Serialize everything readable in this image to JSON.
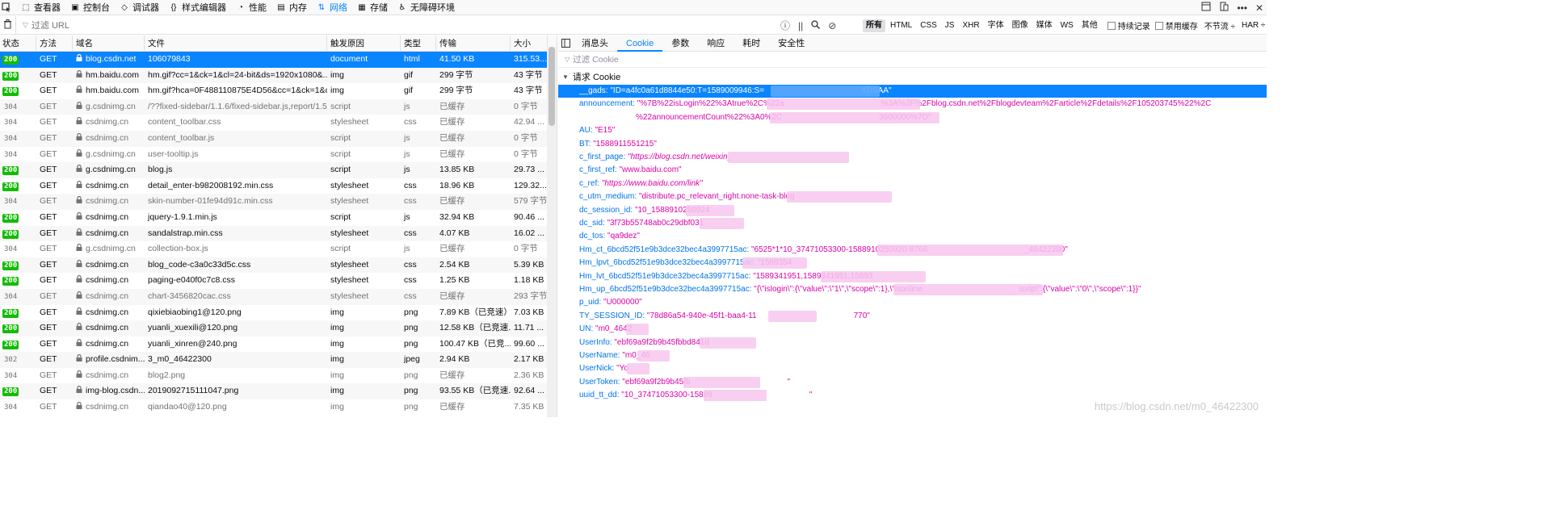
{
  "toolbar": {
    "tabs": [
      {
        "label": "查看器",
        "icon": "inspector-icon"
      },
      {
        "label": "控制台",
        "icon": "console-icon"
      },
      {
        "label": "调试器",
        "icon": "debugger-icon"
      },
      {
        "label": "样式编辑器",
        "icon": "style-editor-icon"
      },
      {
        "label": "性能",
        "icon": "performance-icon"
      },
      {
        "label": "内存",
        "icon": "memory-icon"
      },
      {
        "label": "网络",
        "icon": "network-icon"
      },
      {
        "label": "存储",
        "icon": "storage-icon"
      },
      {
        "label": "无障碍环境",
        "icon": "accessibility-icon"
      }
    ],
    "active_tab": "网络"
  },
  "filterbar": {
    "url_placeholder": "过滤 URL",
    "types": [
      "所有",
      "HTML",
      "CSS",
      "JS",
      "XHR",
      "字体",
      "图像",
      "媒体",
      "WS",
      "其他"
    ],
    "active_type": "所有",
    "persist_logs": "持续记录",
    "disable_cache": "禁用缓存",
    "throttle": "不节流 ÷",
    "har": "HAR ÷"
  },
  "table": {
    "columns": [
      "状态",
      "方法",
      "域名",
      "文件",
      "触发原因",
      "类型",
      "传输",
      "大小"
    ],
    "rows": [
      {
        "status": "200",
        "method": "GET",
        "domain": "blog.csdn.net",
        "file": "106079843",
        "cause": "document",
        "type": "html",
        "transfer": "41.50 KB",
        "size": "315.53...",
        "lock": true,
        "cached": false
      },
      {
        "status": "200",
        "method": "GET",
        "domain": "hm.baidu.com",
        "file": "hm.gif?cc=1&ck=1&cl=24-bit&ds=1920x1080&...",
        "cause": "img",
        "type": "gif",
        "transfer": "299 字节",
        "size": "43 字节",
        "lock": true,
        "cached": false
      },
      {
        "status": "200",
        "method": "GET",
        "domain": "hm.baidu.com",
        "file": "hm.gif?hca=0F488110875E4D56&cc=1&ck=1&c...",
        "cause": "img",
        "type": "gif",
        "transfer": "299 字节",
        "size": "43 字节",
        "lock": true,
        "cached": false
      },
      {
        "status": "304",
        "method": "GET",
        "domain": "g.csdnimg.cn",
        "file": "/??fixed-sidebar/1.1.6/fixed-sidebar.js,report/1.5...",
        "cause": "script",
        "type": "js",
        "transfer": "已缓存",
        "size": "0 字节",
        "lock": true,
        "cached": true
      },
      {
        "status": "304",
        "method": "GET",
        "domain": "csdnimg.cn",
        "file": "content_toolbar.css",
        "cause": "stylesheet",
        "type": "css",
        "transfer": "已缓存",
        "size": "42.94 ...",
        "lock": true,
        "cached": true
      },
      {
        "status": "304",
        "method": "GET",
        "domain": "csdnimg.cn",
        "file": "content_toolbar.js",
        "cause": "script",
        "type": "js",
        "transfer": "已缓存",
        "size": "0 字节",
        "lock": true,
        "cached": true
      },
      {
        "status": "304",
        "method": "GET",
        "domain": "g.csdnimg.cn",
        "file": "user-tooltip.js",
        "cause": "script",
        "type": "js",
        "transfer": "已缓存",
        "size": "0 字节",
        "lock": true,
        "cached": true
      },
      {
        "status": "200",
        "method": "GET",
        "domain": "g.csdnimg.cn",
        "file": "blog.js",
        "cause": "script",
        "type": "js",
        "transfer": "13.85 KB",
        "size": "29.73 ...",
        "lock": true,
        "cached": false
      },
      {
        "status": "200",
        "method": "GET",
        "domain": "csdnimg.cn",
        "file": "detail_enter-b982008192.min.css",
        "cause": "stylesheet",
        "type": "css",
        "transfer": "18.96 KB",
        "size": "129.32...",
        "lock": true,
        "cached": false
      },
      {
        "status": "304",
        "method": "GET",
        "domain": "csdnimg.cn",
        "file": "skin-number-01fe94d91c.min.css",
        "cause": "stylesheet",
        "type": "css",
        "transfer": "已缓存",
        "size": "579 字节",
        "lock": true,
        "cached": true
      },
      {
        "status": "200",
        "method": "GET",
        "domain": "csdnimg.cn",
        "file": "jquery-1.9.1.min.js",
        "cause": "script",
        "type": "js",
        "transfer": "32.94 KB",
        "size": "90.46 ...",
        "lock": true,
        "cached": false
      },
      {
        "status": "200",
        "method": "GET",
        "domain": "csdnimg.cn",
        "file": "sandalstrap.min.css",
        "cause": "stylesheet",
        "type": "css",
        "transfer": "4.07 KB",
        "size": "16.02 ...",
        "lock": true,
        "cached": false
      },
      {
        "status": "304",
        "method": "GET",
        "domain": "g.csdnimg.cn",
        "file": "collection-box.js",
        "cause": "script",
        "type": "js",
        "transfer": "已缓存",
        "size": "0 字节",
        "lock": true,
        "cached": true
      },
      {
        "status": "200",
        "method": "GET",
        "domain": "csdnimg.cn",
        "file": "blog_code-c3a0c33d5c.css",
        "cause": "stylesheet",
        "type": "css",
        "transfer": "2.54 KB",
        "size": "5.39 KB",
        "lock": true,
        "cached": false
      },
      {
        "status": "200",
        "method": "GET",
        "domain": "csdnimg.cn",
        "file": "paging-e040f0c7c8.css",
        "cause": "stylesheet",
        "type": "css",
        "transfer": "1.25 KB",
        "size": "1.18 KB",
        "lock": true,
        "cached": false
      },
      {
        "status": "304",
        "method": "GET",
        "domain": "csdnimg.cn",
        "file": "chart-3456820cac.css",
        "cause": "stylesheet",
        "type": "css",
        "transfer": "已缓存",
        "size": "293 字节",
        "lock": true,
        "cached": true
      },
      {
        "status": "200",
        "method": "GET",
        "domain": "csdnimg.cn",
        "file": "qixiebiaobing1@120.png",
        "cause": "img",
        "type": "png",
        "transfer": "7.89 KB（已竞速）",
        "size": "7.03 KB",
        "lock": true,
        "cached": false
      },
      {
        "status": "200",
        "method": "GET",
        "domain": "csdnimg.cn",
        "file": "yuanli_xuexili@120.png",
        "cause": "img",
        "type": "png",
        "transfer": "12.58 KB（已竞速...",
        "size": "11.71 ...",
        "lock": true,
        "cached": false
      },
      {
        "status": "200",
        "method": "GET",
        "domain": "csdnimg.cn",
        "file": "yuanli_xinren@240.png",
        "cause": "img",
        "type": "png",
        "transfer": "100.47 KB（已竞...",
        "size": "99.60 ...",
        "lock": true,
        "cached": false
      },
      {
        "status": "302",
        "method": "GET",
        "domain": "profile.csdnim...",
        "file": "3_m0_46422300",
        "cause": "img",
        "type": "jpeg",
        "transfer": "2.94 KB",
        "size": "2.17 KB",
        "lock": true,
        "cached": false
      },
      {
        "status": "304",
        "method": "GET",
        "domain": "csdnimg.cn",
        "file": "blog2.png",
        "cause": "img",
        "type": "png",
        "transfer": "已缓存",
        "size": "2.36 KB",
        "lock": true,
        "cached": true
      },
      {
        "status": "200",
        "method": "GET",
        "domain": "img-blog.csdn...",
        "file": "2019092715111047.png",
        "cause": "img",
        "type": "png",
        "transfer": "93.55 KB（已竞速...",
        "size": "92.64 ...",
        "lock": true,
        "cached": false
      },
      {
        "status": "304",
        "method": "GET",
        "domain": "csdnimg.cn",
        "file": "qiandao40@120.png",
        "cause": "img",
        "type": "png",
        "transfer": "已缓存",
        "size": "7.35 KB",
        "lock": true,
        "cached": true
      }
    ]
  },
  "panel": {
    "tabs": [
      "消息头",
      "Cookie",
      "参数",
      "响应",
      "耗时",
      "安全性"
    ],
    "active_tab": "Cookie",
    "filter_placeholder": "过滤 Cookie",
    "section_title": "请求 Cookie",
    "cookies": [
      {
        "key": "__gads:",
        "value": "\"ID=a4fc0a61d8844e50:T=1589009946:S=",
        "tail": "XDSAA\"",
        "italic": false
      },
      {
        "key": "announcement:",
        "value": "\"%7B%22isLogin%22%3Atrue%2C%22a",
        "tail": "%3A%2F%2Fblog.csdn.net%2Fblogdevteam%2Farticle%2Fdetails%2F105203745%22%2C",
        "italic": false
      },
      {
        "key": "",
        "value": "%22announcementCount%22%3A0%2C",
        "tail": "3600000%7D\"",
        "italic": false
      },
      {
        "key": "AU:",
        "value": "\"E15\"",
        "tail": "",
        "italic": false
      },
      {
        "key": "BT:",
        "value": "\"1588911551215\"",
        "tail": "",
        "italic": false
      },
      {
        "key": "c_first_page:",
        "value": "\"https://blog.csdn.net/weixin_",
        "tail": "",
        "italic": true
      },
      {
        "key": "c_first_ref:",
        "value": "\"www.baidu.com\"",
        "tail": "",
        "italic": false
      },
      {
        "key": "c_ref:",
        "value": "\"https://www.baidu.com/link\"",
        "tail": "",
        "italic": true
      },
      {
        "key": "c_utm_medium:",
        "value": "\"distribute.pc_relevant_right.none-task-blog",
        "tail": "",
        "italic": false
      },
      {
        "key": "dc_session_id:",
        "value": "\"10_1588910250924",
        "tail": "",
        "italic": false
      },
      {
        "key": "dc_sid:",
        "value": "\"3f73b55748ab0c29dbf031",
        "tail": "",
        "italic": false
      },
      {
        "key": "dc_tos:",
        "value": "\"qa9dez\"",
        "tail": "",
        "italic": false
      },
      {
        "key": "Hm_ct_6bcd52f51e9b3dce32bec4a3997715ac:",
        "value": "\"6525*1*10_37471053300-1588910250920-8766",
        "tail": "_46422300\"",
        "italic": false
      },
      {
        "key": "Hm_lpvt_6bcd52f51e9b3dce32bec4a3997715ac:",
        "value": "\"1589354",
        "tail": "",
        "italic": false
      },
      {
        "key": "Hm_lvt_6bcd52f51e9b3dce32bec4a3997715ac:",
        "value": "\"1589341951,1589341951,15893",
        "tail": "",
        "italic": false
      },
      {
        "key": "Hm_up_6bcd52f51e9b3dce32bec4a3997715ac:",
        "value": "\"{\\\"islogin\\\":{\\\"value\\\":\\\"1\\\",\\\"scope\\\":1},\\\"isonline",
        "tail": "isvip\\\":{\\\"value\\\":\\\"0\\\",\\\"scope\\\":1}}\"",
        "italic": false
      },
      {
        "key": "p_uid:",
        "value": "\"U000000\"",
        "tail": "",
        "italic": false
      },
      {
        "key": "TY_SESSION_ID:",
        "value": "\"78d86a54-940e-45f1-baa4-11",
        "tail": "770\"",
        "italic": false
      },
      {
        "key": "UN:",
        "value": "\"m0_4642",
        "tail": "",
        "italic": false
      },
      {
        "key": "UserInfo:",
        "value": "\"ebf69a9f2b9b45fbbd841d",
        "tail": "",
        "italic": false
      },
      {
        "key": "UserName:",
        "value": "\"m0_46",
        "tail": "",
        "italic": false
      },
      {
        "key": "UserNick:",
        "value": "\"Yo",
        "tail": "",
        "italic": false
      },
      {
        "key": "UserToken:",
        "value": "\"ebf69a9f2b9b45fb",
        "tail": "\"",
        "italic": false
      },
      {
        "key": "uuid_tt_dd:",
        "value": "\"10_37471053300-15889",
        "tail": "\"",
        "italic": false
      }
    ]
  },
  "watermark": "https://blog.csdn.net/m0_46422300",
  "colors": {
    "accent": "#0a84ff",
    "ok": "#12bc00",
    "cookie_key": "#0074e8",
    "cookie_value": "#dd00a9"
  }
}
